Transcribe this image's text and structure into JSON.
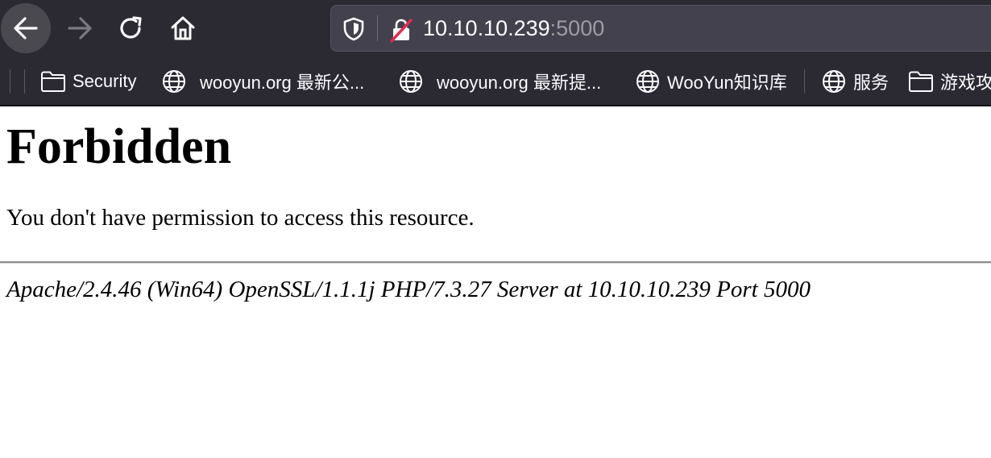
{
  "browser": {
    "url_host": "10.10.10.239",
    "url_port": ":5000"
  },
  "bookmarks": [
    {
      "label": "Security",
      "icon": "folder-icon"
    },
    {
      "label": "wooyun.org 最新公...",
      "icon": "globe-icon"
    },
    {
      "label": "wooyun.org 最新提...",
      "icon": "globe-icon"
    },
    {
      "label": "WooYun知识库",
      "icon": "globe-icon"
    },
    {
      "label": "服务",
      "icon": "globe-icon"
    },
    {
      "label": "游戏攻",
      "icon": "folder-icon"
    }
  ],
  "page": {
    "heading": "Forbidden",
    "message": "You don't have permission to access this resource.",
    "server_signature": "Apache/2.4.46 (Win64) OpenSSL/1.1.1j PHP/7.3.27 Server at 10.10.10.239 Port 5000"
  },
  "colors": {
    "toolbar_bg": "#2b2a33",
    "urlbar_bg": "#42414d",
    "text_light": "#fbfbfe",
    "port_text": "#9e9ea6"
  }
}
